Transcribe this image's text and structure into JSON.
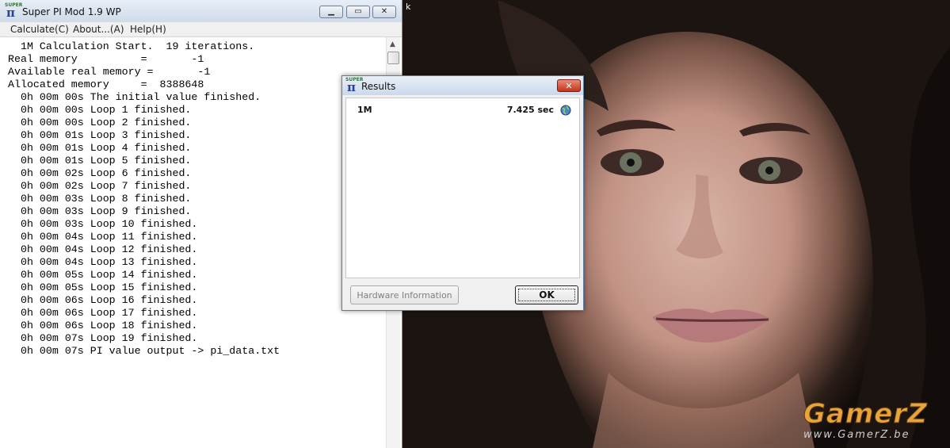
{
  "main_window": {
    "title": "Super PI Mod 1.9 WP",
    "icon_text": "SUPER",
    "menu": [
      "Calculate(C)",
      "About...(A)",
      "Help(H)"
    ],
    "log_lines": [
      "  1M Calculation Start.  19 iterations.",
      "Real memory          =       -1",
      "Available real memory =       -1",
      "Allocated memory     =  8388648",
      "  0h 00m 00s The initial value finished.",
      "  0h 00m 00s Loop 1 finished.",
      "  0h 00m 00s Loop 2 finished.",
      "  0h 00m 01s Loop 3 finished.",
      "  0h 00m 01s Loop 4 finished.",
      "  0h 00m 01s Loop 5 finished.",
      "  0h 00m 02s Loop 6 finished.",
      "  0h 00m 02s Loop 7 finished.",
      "  0h 00m 03s Loop 8 finished.",
      "  0h 00m 03s Loop 9 finished.",
      "  0h 00m 03s Loop 10 finished.",
      "  0h 00m 04s Loop 11 finished.",
      "  0h 00m 04s Loop 12 finished.",
      "  0h 00m 04s Loop 13 finished.",
      "  0h 00m 05s Loop 14 finished.",
      "  0h 00m 05s Loop 15 finished.",
      "  0h 00m 06s Loop 16 finished.",
      "  0h 00m 06s Loop 17 finished.",
      "  0h 00m 06s Loop 18 finished.",
      "  0h 00m 07s Loop 19 finished.",
      "  0h 00m 07s PI value output -> pi_data.txt"
    ]
  },
  "results_window": {
    "title": "Results",
    "icon_text": "SUPER",
    "result_label": "1M",
    "result_time": "7.425 sec",
    "hardware_button": "Hardware Information",
    "ok_button": "OK"
  },
  "desktop": {
    "partial_icon_text": "k",
    "watermark_logo": "GamerZ",
    "watermark_url": "www.GamerZ.be"
  },
  "colors": {
    "titlebar": "#cfdbe9",
    "close_red": "#c3341b",
    "watermark_orange": "#e9a33a"
  },
  "icons": {
    "app_icon": "super-pi-icon",
    "globe_icon": "globe-icon"
  }
}
